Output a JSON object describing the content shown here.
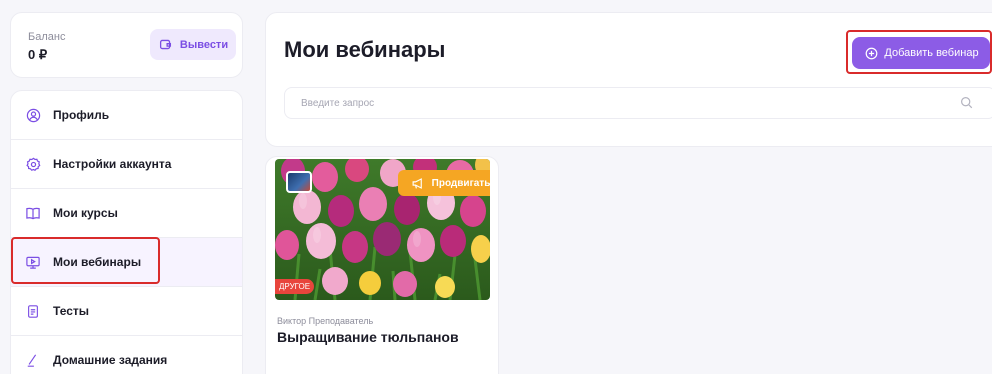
{
  "balance": {
    "label": "Баланс",
    "value": "0 ₽",
    "withdraw_label": "Вывести",
    "withdraw_icon": "wallet-icon"
  },
  "sidebar": {
    "items": [
      {
        "label": "Профиль",
        "icon": "user-circle-icon",
        "active": false
      },
      {
        "label": "Настройки аккаунта",
        "icon": "gear-icon",
        "active": false
      },
      {
        "label": "Мои курсы",
        "icon": "book-icon",
        "active": false
      },
      {
        "label": "Мои вебинары",
        "icon": "monitor-play-icon",
        "active": true
      },
      {
        "label": "Тесты",
        "icon": "document-icon",
        "active": false
      },
      {
        "label": "Домашние задания",
        "icon": "pen-icon",
        "active": false
      }
    ]
  },
  "header": {
    "title": "Мои вебинары",
    "add_button_label": "Добавить вебинар",
    "add_button_icon": "plus-circle-icon"
  },
  "search": {
    "placeholder": "Введите запрос",
    "value": ""
  },
  "webinars": [
    {
      "author": "Виктор Преподаватель",
      "title": "Выращивание тюльпанов",
      "category": "ДРУГОЕ",
      "promote_label": "Продвигать",
      "promote_icon": "megaphone-icon"
    }
  ],
  "colors": {
    "accent": "#8c5ce6",
    "accent_light": "#efe9fd",
    "promote": "#f5a623",
    "badge": "#e8453c",
    "annotation_box": "#d92b2b"
  }
}
